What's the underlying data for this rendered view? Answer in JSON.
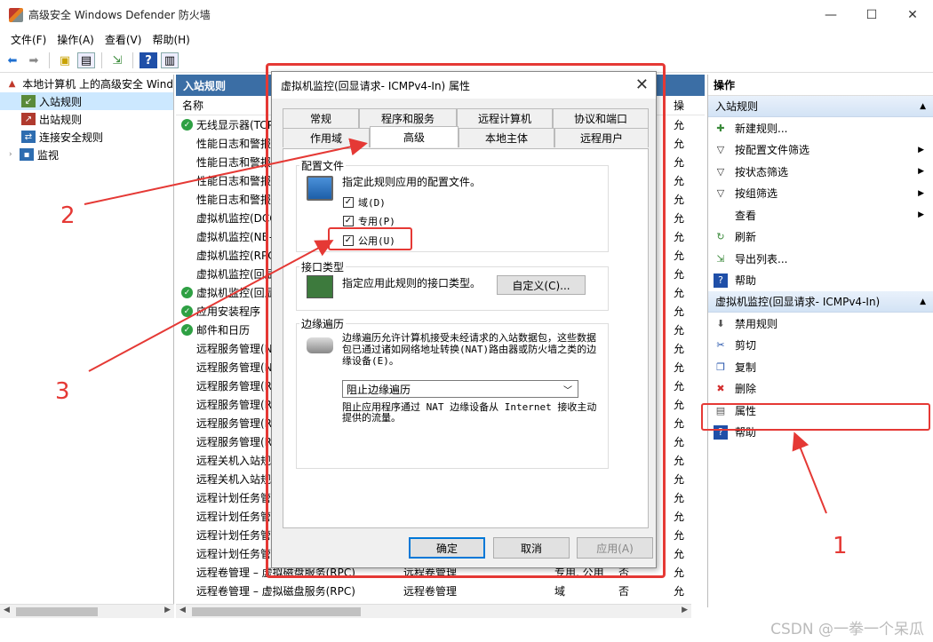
{
  "window": {
    "title": "高级安全 Windows Defender 防火墙",
    "minimize": "—",
    "maximize": "☐",
    "close": "✕"
  },
  "menu": [
    "文件(F)",
    "操作(A)",
    "查看(V)",
    "帮助(H)"
  ],
  "tree": {
    "root": "本地计算机 上的高级安全 Wind",
    "items": [
      "入站规则",
      "出站规则",
      "连接安全规则",
      "监视"
    ]
  },
  "middle": {
    "header": "入站规则",
    "col_name": "名称",
    "col_last": "操",
    "rows": [
      {
        "name": "无线显示器(TCP",
        "enabled": true,
        "last": "允"
      },
      {
        "name": "性能日志和警报",
        "enabled": false,
        "last": "允"
      },
      {
        "name": "性能日志和警报",
        "enabled": false,
        "last": "允"
      },
      {
        "name": "性能日志和警报",
        "enabled": false,
        "last": "允"
      },
      {
        "name": "性能日志和警报",
        "enabled": false,
        "last": "允"
      },
      {
        "name": "虚拟机监控(DCO",
        "enabled": false,
        "last": "允"
      },
      {
        "name": "虚拟机监控(NB-",
        "enabled": false,
        "last": "允"
      },
      {
        "name": "虚拟机监控(RPC",
        "enabled": false,
        "last": "允"
      },
      {
        "name": "虚拟机监控(回显",
        "enabled": false,
        "last": "允"
      },
      {
        "name": "虚拟机监控(回显",
        "enabled": true,
        "last": "允"
      },
      {
        "name": "应用安装程序",
        "enabled": true,
        "last": "允"
      },
      {
        "name": "邮件和日历",
        "enabled": true,
        "last": "允"
      },
      {
        "name": "远程服务管理(N",
        "enabled": false,
        "last": "允"
      },
      {
        "name": "远程服务管理(N",
        "enabled": false,
        "last": "允"
      },
      {
        "name": "远程服务管理(R",
        "enabled": false,
        "last": "允"
      },
      {
        "name": "远程服务管理(R",
        "enabled": false,
        "last": "允"
      },
      {
        "name": "远程服务管理(R",
        "enabled": false,
        "last": "允"
      },
      {
        "name": "远程服务管理(R",
        "enabled": false,
        "last": "允"
      },
      {
        "name": "远程关机入站规",
        "enabled": false,
        "last": "允"
      },
      {
        "name": "远程关机入站规",
        "enabled": false,
        "last": "允"
      },
      {
        "name": "远程计划任务管",
        "enabled": false,
        "last": "允"
      },
      {
        "name": "远程计划任务管",
        "enabled": false,
        "last": "允"
      },
      {
        "name": "远程计划任务管",
        "enabled": false,
        "last": "允"
      },
      {
        "name": "远程计划任务管",
        "enabled": false,
        "last": "允"
      }
    ],
    "bottom_rows": [
      {
        "name": "远程卷管理 – 虚拟磁盘服务(RPC)",
        "group": "远程卷管理",
        "profile": "专用, 公用",
        "enabled": "否",
        "last": "允"
      },
      {
        "name": "远程卷管理 – 虚拟磁盘服务(RPC)",
        "group": "远程卷管理",
        "profile": "域",
        "enabled": "否",
        "last": "允"
      }
    ]
  },
  "actions": {
    "header": "操作",
    "sec1": "入站规则",
    "items1": [
      {
        "label": "新建规则...",
        "icon": "new-rule-icon"
      },
      {
        "label": "按配置文件筛选",
        "icon": "filter-icon",
        "sub": true
      },
      {
        "label": "按状态筛选",
        "icon": "filter-icon",
        "sub": true
      },
      {
        "label": "按组筛选",
        "icon": "filter-icon",
        "sub": true
      },
      {
        "label": "查看",
        "icon": "",
        "sub": true
      },
      {
        "label": "刷新",
        "icon": "refresh-icon"
      },
      {
        "label": "导出列表...",
        "icon": "export-icon"
      },
      {
        "label": "帮助",
        "icon": "help-icon"
      }
    ],
    "sec2": "虚拟机监控(回显请求- ICMPv4-In)",
    "items2": [
      {
        "label": "禁用规则",
        "icon": "disable-icon"
      },
      {
        "label": "剪切",
        "icon": "cut-icon"
      },
      {
        "label": "复制",
        "icon": "copy-icon"
      },
      {
        "label": "删除",
        "icon": "delete-icon"
      },
      {
        "label": "属性",
        "icon": "properties-icon"
      },
      {
        "label": "帮助",
        "icon": "help-icon"
      }
    ]
  },
  "dialog": {
    "title": "虚拟机监控(回显请求- ICMPv4-In) 属性",
    "tabs_row1": [
      "常规",
      "程序和服务",
      "远程计算机",
      "协议和端口"
    ],
    "tabs_row2": [
      "作用域",
      "高级",
      "本地主体",
      "远程用户"
    ],
    "profile_group": "配置文件",
    "profile_desc": "指定此规则应用的配置文件。",
    "profiles": [
      {
        "label": "域(D)",
        "checked": true
      },
      {
        "label": "专用(P)",
        "checked": true
      },
      {
        "label": "公用(U)",
        "checked": true
      }
    ],
    "iface_group": "接口类型",
    "iface_desc": "指定应用此规则的接口类型。",
    "customize": "自定义(C)...",
    "edge_group": "边缘遍历",
    "edge_desc": "边缘遍历允许计算机接受未经请求的入站数据包，这些数据包已通过诸如网络地址转换(NAT)路由器或防火墙之类的边缘设备(E)。",
    "edge_select": "阻止边缘遍历",
    "edge_note": "阻止应用程序通过 NAT 边缘设备从 Internet 接收主动提供的流量。",
    "ok": "确定",
    "cancel": "取消",
    "apply": "应用(A)"
  },
  "annotations": [
    "1",
    "2",
    "3"
  ],
  "watermark": "CSDN @一拳一个呆瓜",
  "colors": {
    "accent": "#3b6ea5",
    "annotation": "#e53935",
    "selected": "#cce8ff"
  }
}
